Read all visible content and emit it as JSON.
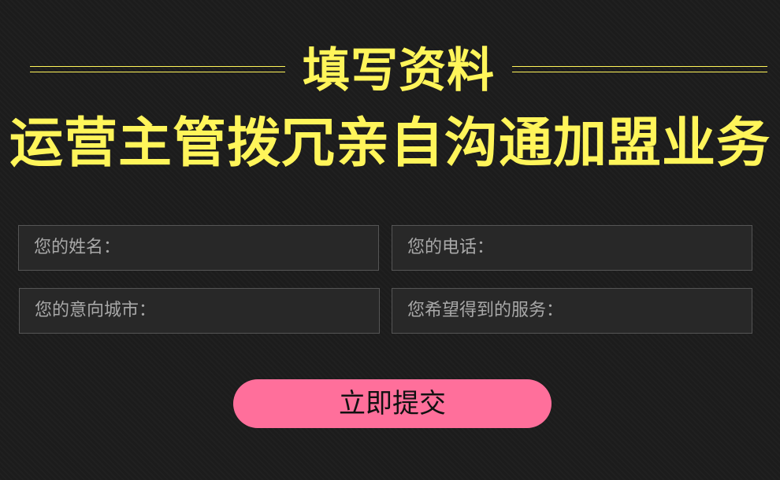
{
  "header": {
    "title": "填写资料",
    "subtitle": "运营主管拨冗亲自沟通加盟业务"
  },
  "form": {
    "name_placeholder": "您的姓名：",
    "phone_placeholder": "您的电话：",
    "city_placeholder": "您的意向城市：",
    "service_placeholder": "您希望得到的服务：",
    "submit_label": "立即提交"
  },
  "colors": {
    "background": "#1c1c1c",
    "accent_yellow": "#fff55a",
    "submit_pink": "#ff6f9b",
    "field_background": "#282828",
    "field_border": "#555555"
  }
}
